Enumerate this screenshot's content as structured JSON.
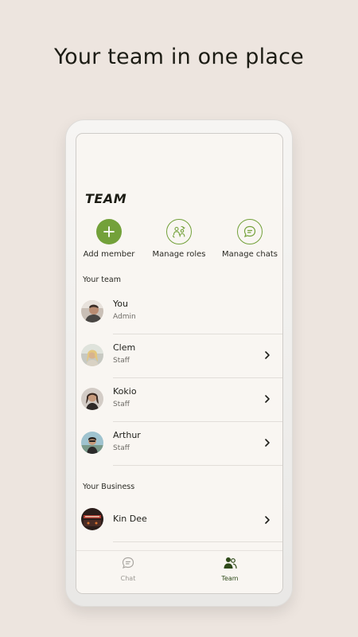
{
  "headline": "Your team in one place",
  "screen": {
    "title": "TEAM",
    "actions": [
      {
        "label": "Add member",
        "icon": "plus-icon"
      },
      {
        "label": "Manage roles",
        "icon": "manage-roles-icon"
      },
      {
        "label": "Manage chats",
        "icon": "chat-bubble-icon"
      }
    ],
    "your_team_label": "Your team",
    "members": [
      {
        "name": "You",
        "role": "Admin"
      },
      {
        "name": "Clem",
        "role": "Staff"
      },
      {
        "name": "Kokio",
        "role": "Staff"
      },
      {
        "name": "Arthur",
        "role": "Staff"
      }
    ],
    "your_business_label": "Your Business",
    "business": {
      "name": "Kin Dee"
    },
    "nav": [
      {
        "label": "Chat",
        "icon": "chat-icon"
      },
      {
        "label": "Team",
        "icon": "team-icon"
      }
    ]
  },
  "colors": {
    "accent": "#73a13a",
    "background": "#ede5df",
    "screen_bg": "#f9f6f2"
  }
}
